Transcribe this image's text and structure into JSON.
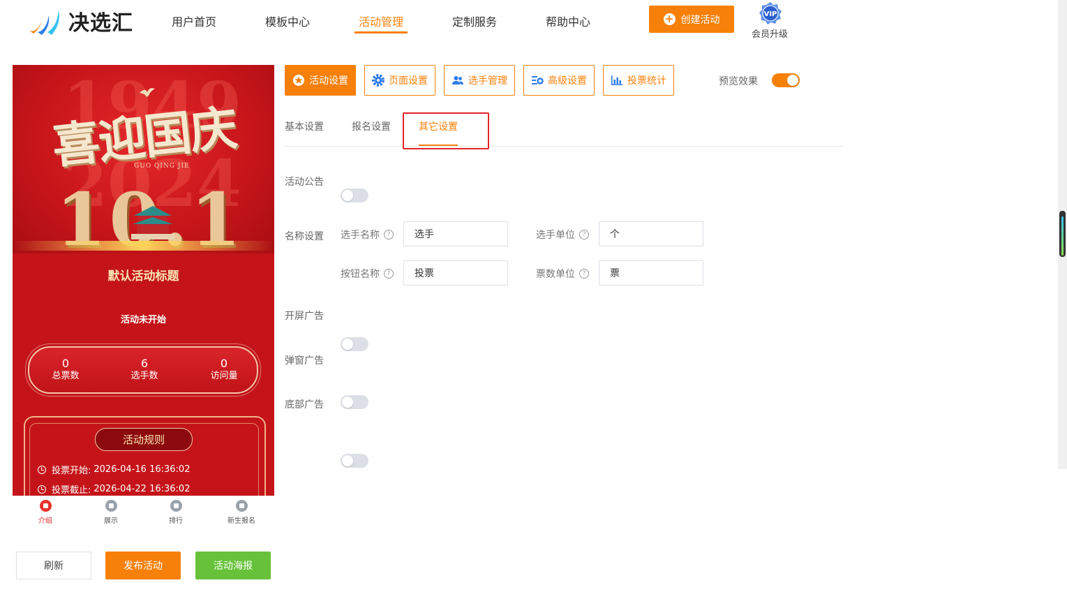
{
  "header": {
    "logo_text": "决选汇",
    "nav": [
      {
        "label": "用户首页"
      },
      {
        "label": "模板中心"
      },
      {
        "label": "活动管理"
      },
      {
        "label": "定制服务"
      },
      {
        "label": "帮助中心"
      }
    ],
    "active_nav": "活动管理",
    "create_label": "创建活动",
    "vip_badge": "VIP",
    "vip_label": "会员升级"
  },
  "preview": {
    "hero_title": "喜迎国庆",
    "hero_subtitle": "GUO QING JIE",
    "hero_number": "10.1",
    "hero_year_top": "1949",
    "hero_year_bottom": "2024",
    "activity_title": "默认活动标题",
    "status": "活动未开始",
    "stats": [
      {
        "value": "0",
        "label": "总票数"
      },
      {
        "value": "6",
        "label": "选手数"
      },
      {
        "value": "0",
        "label": "访问量"
      }
    ],
    "rules_label": "活动规则",
    "vote_start_label": "投票开始:",
    "vote_start": "2026-04-16 16:36:02",
    "vote_end_label": "投票截止:",
    "vote_end": "2026-04-22 16:36:02",
    "tabbar": [
      {
        "label": "介绍"
      },
      {
        "label": "展示"
      },
      {
        "label": "排行"
      },
      {
        "label": "新生报名"
      }
    ]
  },
  "actions": {
    "refresh": "刷新",
    "publish": "发布活动",
    "poster": "活动海报"
  },
  "toolbar": {
    "buttons": [
      {
        "label": "活动设置"
      },
      {
        "label": "页面设置"
      },
      {
        "label": "选手管理"
      },
      {
        "label": "高级设置"
      },
      {
        "label": "投票统计"
      }
    ],
    "preview_label": "预览效果",
    "preview_on": true
  },
  "subtabs": [
    {
      "label": "基本设置"
    },
    {
      "label": "报名设置"
    },
    {
      "label": "其它设置"
    }
  ],
  "settings": {
    "announcement_label": "活动公告",
    "name_settings_label": "名称设置",
    "player_name_label": "选手名称",
    "player_name_value": "选手",
    "player_unit_label": "选手单位",
    "player_unit_value": "个",
    "button_name_label": "按钮名称",
    "button_name_value": "投票",
    "vote_unit_label": "票数单位",
    "vote_unit_value": "票",
    "splash_ad_label": "开屏广告",
    "popup_ad_label": "弹窗广告",
    "bottom_ad_label": "底部广告",
    "qmark": "?"
  },
  "colors": {
    "accent": "#f7800a",
    "poster_green": "#67c23a",
    "highlight_red": "#e2242a"
  }
}
